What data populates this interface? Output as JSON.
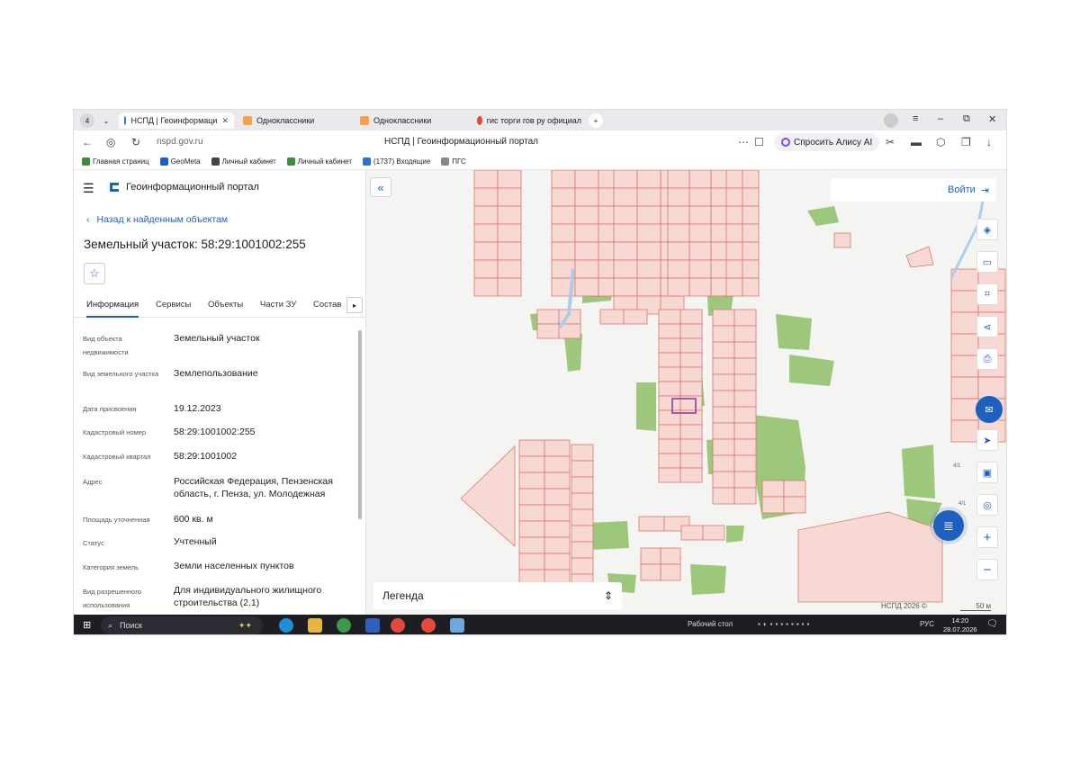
{
  "browser": {
    "tab_count": "4",
    "tabs": [
      {
        "label": "НСПД | Геоинформаци"
      },
      {
        "label": "Одноклассники"
      },
      {
        "label": "Одноклассники"
      },
      {
        "label": "гис торги гов ру официал"
      }
    ],
    "url": "nspd.gov.ru",
    "page_title": "НСПД | Геоинформационный портал",
    "alice_label": "Спросить Алису AI",
    "bookmarks": [
      {
        "label": "Главная страниц",
        "color": "#3a8f3a"
      },
      {
        "label": "GeoMeta",
        "color": "#1e5fbf"
      },
      {
        "label": "Личный кабинет",
        "color": "#444"
      },
      {
        "label": "Личный кабинет",
        "color": "#3a8f3a"
      },
      {
        "label": "(1737) Входящие",
        "color": "#2f6fd6"
      },
      {
        "label": "ПГС",
        "color": "#888"
      }
    ]
  },
  "panel": {
    "portal_title": "Геоинформационный портал",
    "back_label": "Назад к найденным объектам",
    "object_title": "Земельный участок: 58:29:1001002:255",
    "tabs": [
      "Информация",
      "Сервисы",
      "Объекты",
      "Части ЗУ",
      "Состав"
    ],
    "fields": [
      {
        "label": "Вид объекта недвижимости",
        "value": "Земельный участок"
      },
      {
        "label": "Вид земельного участка",
        "value": "Землепользование"
      },
      {
        "label": "Дата присвоения",
        "value": "19.12.2023"
      },
      {
        "label": "Кадастровый номер",
        "value": "58:29:1001002:255"
      },
      {
        "label": "Кадастровый квартал",
        "value": "58:29:1001002"
      },
      {
        "label": "Адрес",
        "value": "Российская Федерация, Пензенская область, г. Пенза, ул. Молодежная"
      },
      {
        "label": "Площадь уточненная",
        "value": "600 кв. м"
      },
      {
        "label": "Статус",
        "value": "Учтенный"
      },
      {
        "label": "Категория земель",
        "value": "Земли населенных пунктов"
      },
      {
        "label": "Вид разрешенного использования",
        "value": "Для индивидуального жилищного строительства (2.1)"
      }
    ]
  },
  "map": {
    "login_label": "Войти",
    "legend_label": "Легенда",
    "copyright": "НСПД 2026 ©",
    "scale_label": "50 м",
    "building_labels": [
      "4/1",
      "4/1"
    ],
    "colors": {
      "parcel_fill": "#f8d8d2",
      "parcel_line": "#d9776a",
      "greenery": "#9dc77a",
      "selected": "#8b3fa6",
      "water": "#aecbeb"
    }
  },
  "taskbar": {
    "search_label": "Поиск",
    "desktop_label": "Рабочий стол",
    "lang": "РУС",
    "time": "14:20",
    "date": "28.07.2026"
  }
}
